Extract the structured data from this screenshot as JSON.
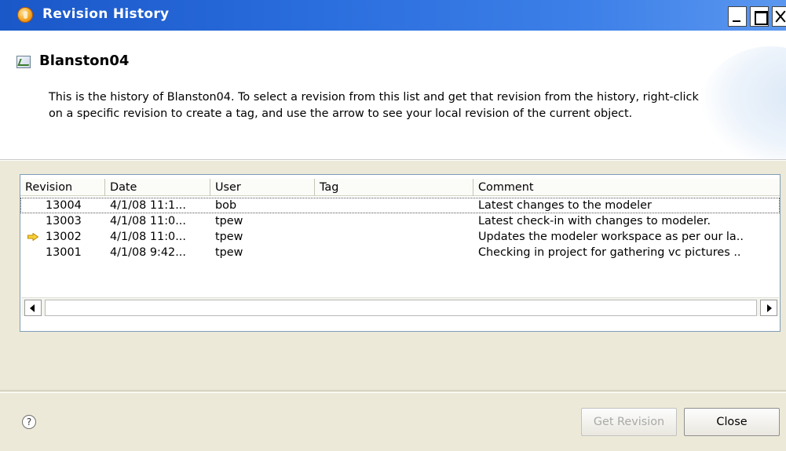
{
  "window": {
    "title": "Revision History",
    "icon": "eclipse-app-icon"
  },
  "header": {
    "object_name": "Blanston04",
    "object_icon": "model-object-icon",
    "description": "This is the history of Blanston04.  To select a revision from this list and get that revision from the history, right-click on a specific revision to create a tag, and use the arrow to see your local revision of the current object."
  },
  "table": {
    "columns": [
      "Revision",
      "Date",
      "User",
      "Tag",
      "Comment"
    ],
    "rows": [
      {
        "revision": "13004",
        "date": "4/1/08 11:1...",
        "user": "bob",
        "tag": "",
        "comment": "Latest changes to the modeler",
        "selected": true,
        "current": false
      },
      {
        "revision": "13003",
        "date": "4/1/08 11:0...",
        "user": "tpew",
        "tag": "",
        "comment": "Latest check-in with changes to modeler.",
        "selected": false,
        "current": false
      },
      {
        "revision": "13002",
        "date": "4/1/08 11:0...",
        "user": "tpew",
        "tag": "",
        "comment": "Updates the modeler workspace as per our la..",
        "selected": false,
        "current": true
      },
      {
        "revision": "13001",
        "date": "4/1/08 9:42...",
        "user": "tpew",
        "tag": "",
        "comment": "Checking in project for gathering vc pictures ..",
        "selected": false,
        "current": false
      }
    ]
  },
  "footer": {
    "help_icon": "?",
    "get_revision_label": "Get Revision",
    "close_label": "Close"
  },
  "colors": {
    "titlebar": "#2a6ddd",
    "dialog_bg": "#ece9d8",
    "current_arrow": "#f0b400"
  }
}
